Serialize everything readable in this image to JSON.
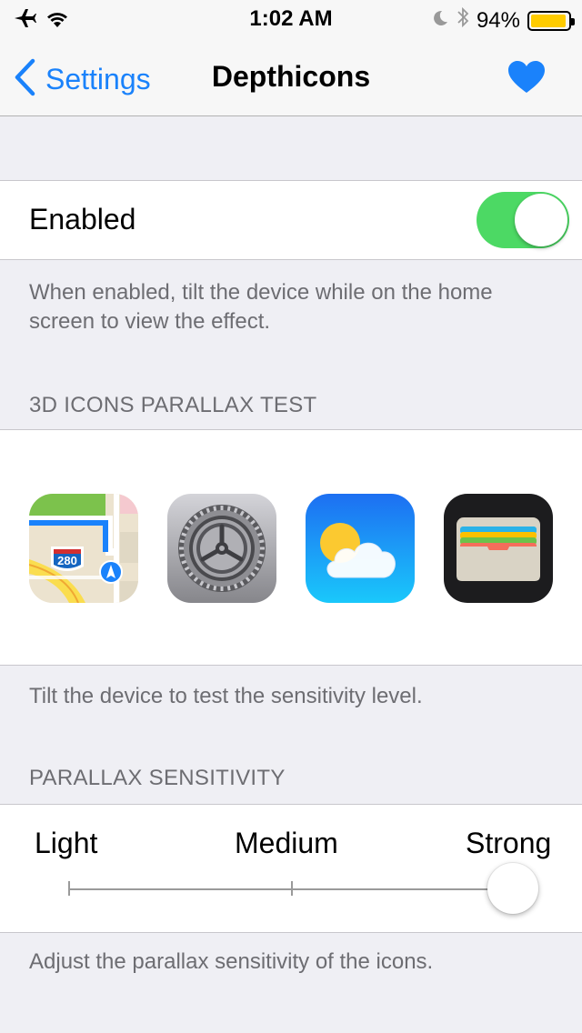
{
  "status_bar": {
    "time": "1:02 AM",
    "battery_text": "94%",
    "battery_level": 0.94,
    "battery_color": "#ffcc00"
  },
  "nav": {
    "back_label": "Settings",
    "title": "Depthicons",
    "accent_color": "#1a82fb"
  },
  "enabled_cell": {
    "label": "Enabled",
    "on": true,
    "toggle_color": "#4cd964"
  },
  "enabled_footer": "When enabled, tilt the device while on the home screen to view the effect.",
  "icons_section": {
    "header": "3D ICONS PARALLAX TEST",
    "icons": [
      {
        "name": "maps-app-icon",
        "badge": "280"
      },
      {
        "name": "settings-app-icon"
      },
      {
        "name": "weather-app-icon"
      },
      {
        "name": "wallet-app-icon"
      }
    ],
    "footer": "Tilt the device to test the sensitivity level."
  },
  "sensitivity_section": {
    "header": "PARALLAX SENSITIVITY",
    "labels": [
      "Light",
      "Medium",
      "Strong"
    ],
    "selected": "Strong",
    "footer": "Adjust the parallax sensitivity of the icons."
  }
}
